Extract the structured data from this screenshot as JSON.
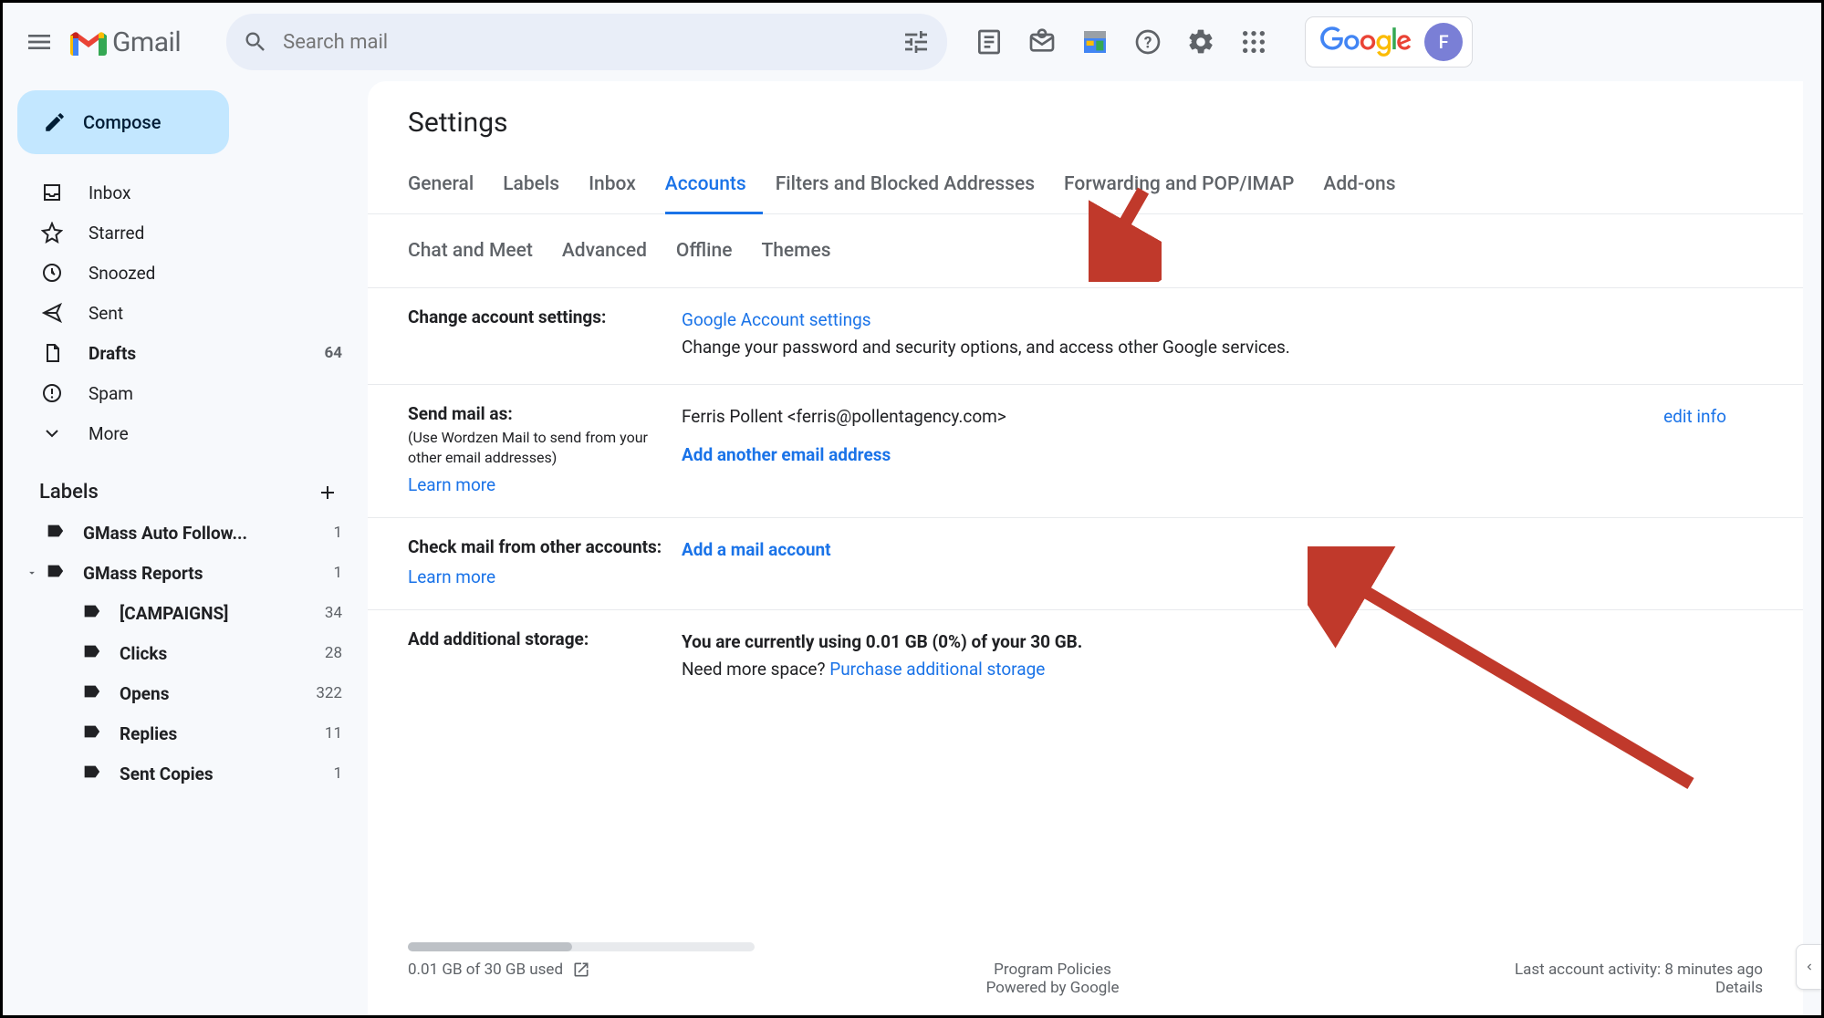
{
  "header": {
    "product": "Gmail",
    "search_placeholder": "Search mail",
    "google_text": "Google",
    "avatar_initial": "F"
  },
  "sidebar": {
    "compose": "Compose",
    "items": [
      {
        "icon": "inbox",
        "label": "Inbox",
        "count": ""
      },
      {
        "icon": "star",
        "label": "Starred",
        "count": ""
      },
      {
        "icon": "clock",
        "label": "Snoozed",
        "count": ""
      },
      {
        "icon": "send",
        "label": "Sent",
        "count": ""
      },
      {
        "icon": "file",
        "label": "Drafts",
        "count": "64",
        "bold": true
      },
      {
        "icon": "spam",
        "label": "Spam",
        "count": ""
      },
      {
        "icon": "more",
        "label": "More",
        "count": ""
      }
    ],
    "labels_title": "Labels",
    "labels": [
      {
        "label": "GMass Auto Follow...",
        "count": "1",
        "chev": false,
        "child": false
      },
      {
        "label": "GMass Reports",
        "count": "1",
        "chev": true,
        "child": false
      },
      {
        "label": "[CAMPAIGNS]",
        "count": "34",
        "chev": false,
        "child": true
      },
      {
        "label": "Clicks",
        "count": "28",
        "chev": false,
        "child": true
      },
      {
        "label": "Opens",
        "count": "322",
        "chev": false,
        "child": true
      },
      {
        "label": "Replies",
        "count": "11",
        "chev": false,
        "child": true
      },
      {
        "label": "Sent Copies",
        "count": "1",
        "chev": false,
        "child": true
      }
    ]
  },
  "main": {
    "title": "Settings",
    "tabs_row1": [
      "General",
      "Labels",
      "Inbox",
      "Accounts",
      "Filters and Blocked Addresses",
      "Forwarding and POP/IMAP",
      "Add-ons"
    ],
    "active_tab": "Accounts",
    "tabs_row2": [
      "Chat and Meet",
      "Advanced",
      "Offline",
      "Themes"
    ],
    "sections": {
      "change_account": {
        "label": "Change account settings:",
        "link": "Google Account settings",
        "desc": "Change your password and security options, and access other Google services."
      },
      "send_mail": {
        "label": "Send mail as:",
        "sub": "(Use Wordzen Mail to send from your other email addresses)",
        "learn": "Learn more",
        "identity": "Ferris Pollent <ferris@pollentagency.com>",
        "add_link": "Add another email address",
        "edit": "edit info"
      },
      "check_mail": {
        "label": "Check mail from other accounts:",
        "learn": "Learn more",
        "add_link": "Add a mail account"
      },
      "storage": {
        "label": "Add additional storage:",
        "text": "You are currently using 0.01 GB (0%) of your 30 GB.",
        "need": "Need more space? ",
        "purchase": "Purchase additional storage"
      }
    },
    "footer": {
      "usage": "0.01 GB of 30 GB used",
      "policies": "Program Policies",
      "powered": "Powered by Google",
      "activity": "Last account activity: 8 minutes ago",
      "details": "Details"
    }
  }
}
